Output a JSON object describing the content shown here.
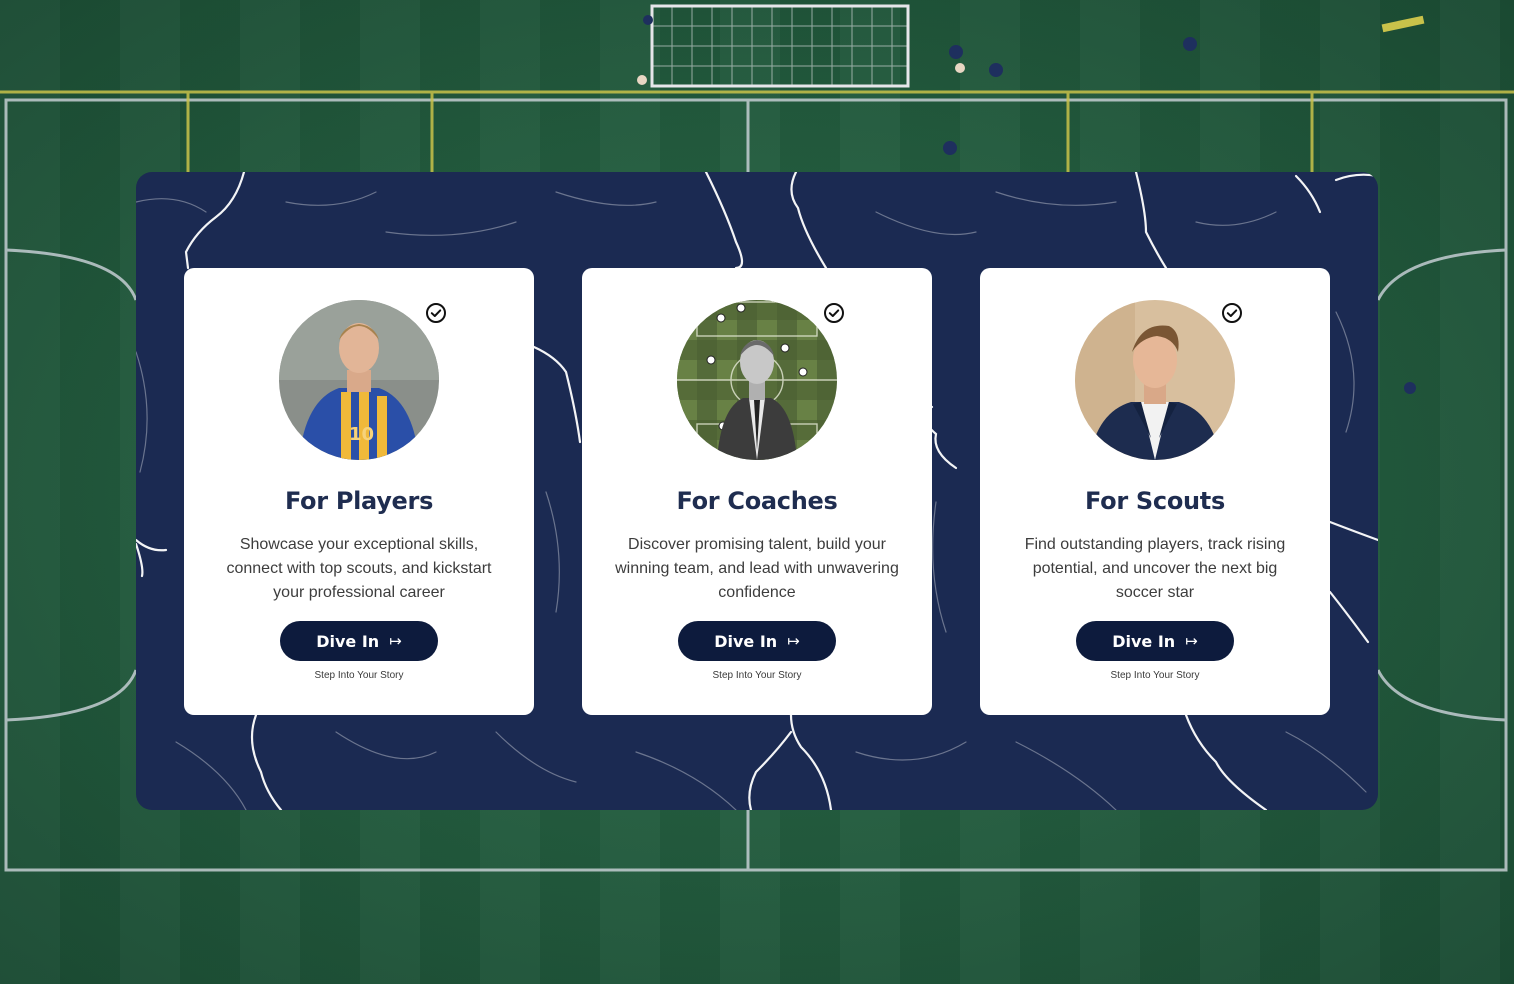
{
  "cards": [
    {
      "title": "For Players",
      "description": "Showcase your exceptional skills, connect with top scouts, and kickstart your professional career",
      "button_label": "Dive In",
      "button_icon": "arrow-right-to-bar-icon",
      "subtext": "Step Into Your Story",
      "jersey_number": "10"
    },
    {
      "title": "For Coaches",
      "description": "Discover promising talent, build your winning team, and lead with unwavering confidence",
      "button_label": "Dive In",
      "button_icon": "arrow-right-to-bar-icon",
      "subtext": "Step Into Your Story"
    },
    {
      "title": "For Scouts",
      "description": "Find outstanding players, track rising potential, and uncover the next big soccer star",
      "button_label": "Dive In",
      "button_icon": "arrow-right-to-bar-icon",
      "subtext": "Step Into Your Story"
    }
  ],
  "colors": {
    "panel": "#1b2a52",
    "button": "#0d1b3d",
    "title": "#1f2d50",
    "pitch": "#225a3d"
  }
}
